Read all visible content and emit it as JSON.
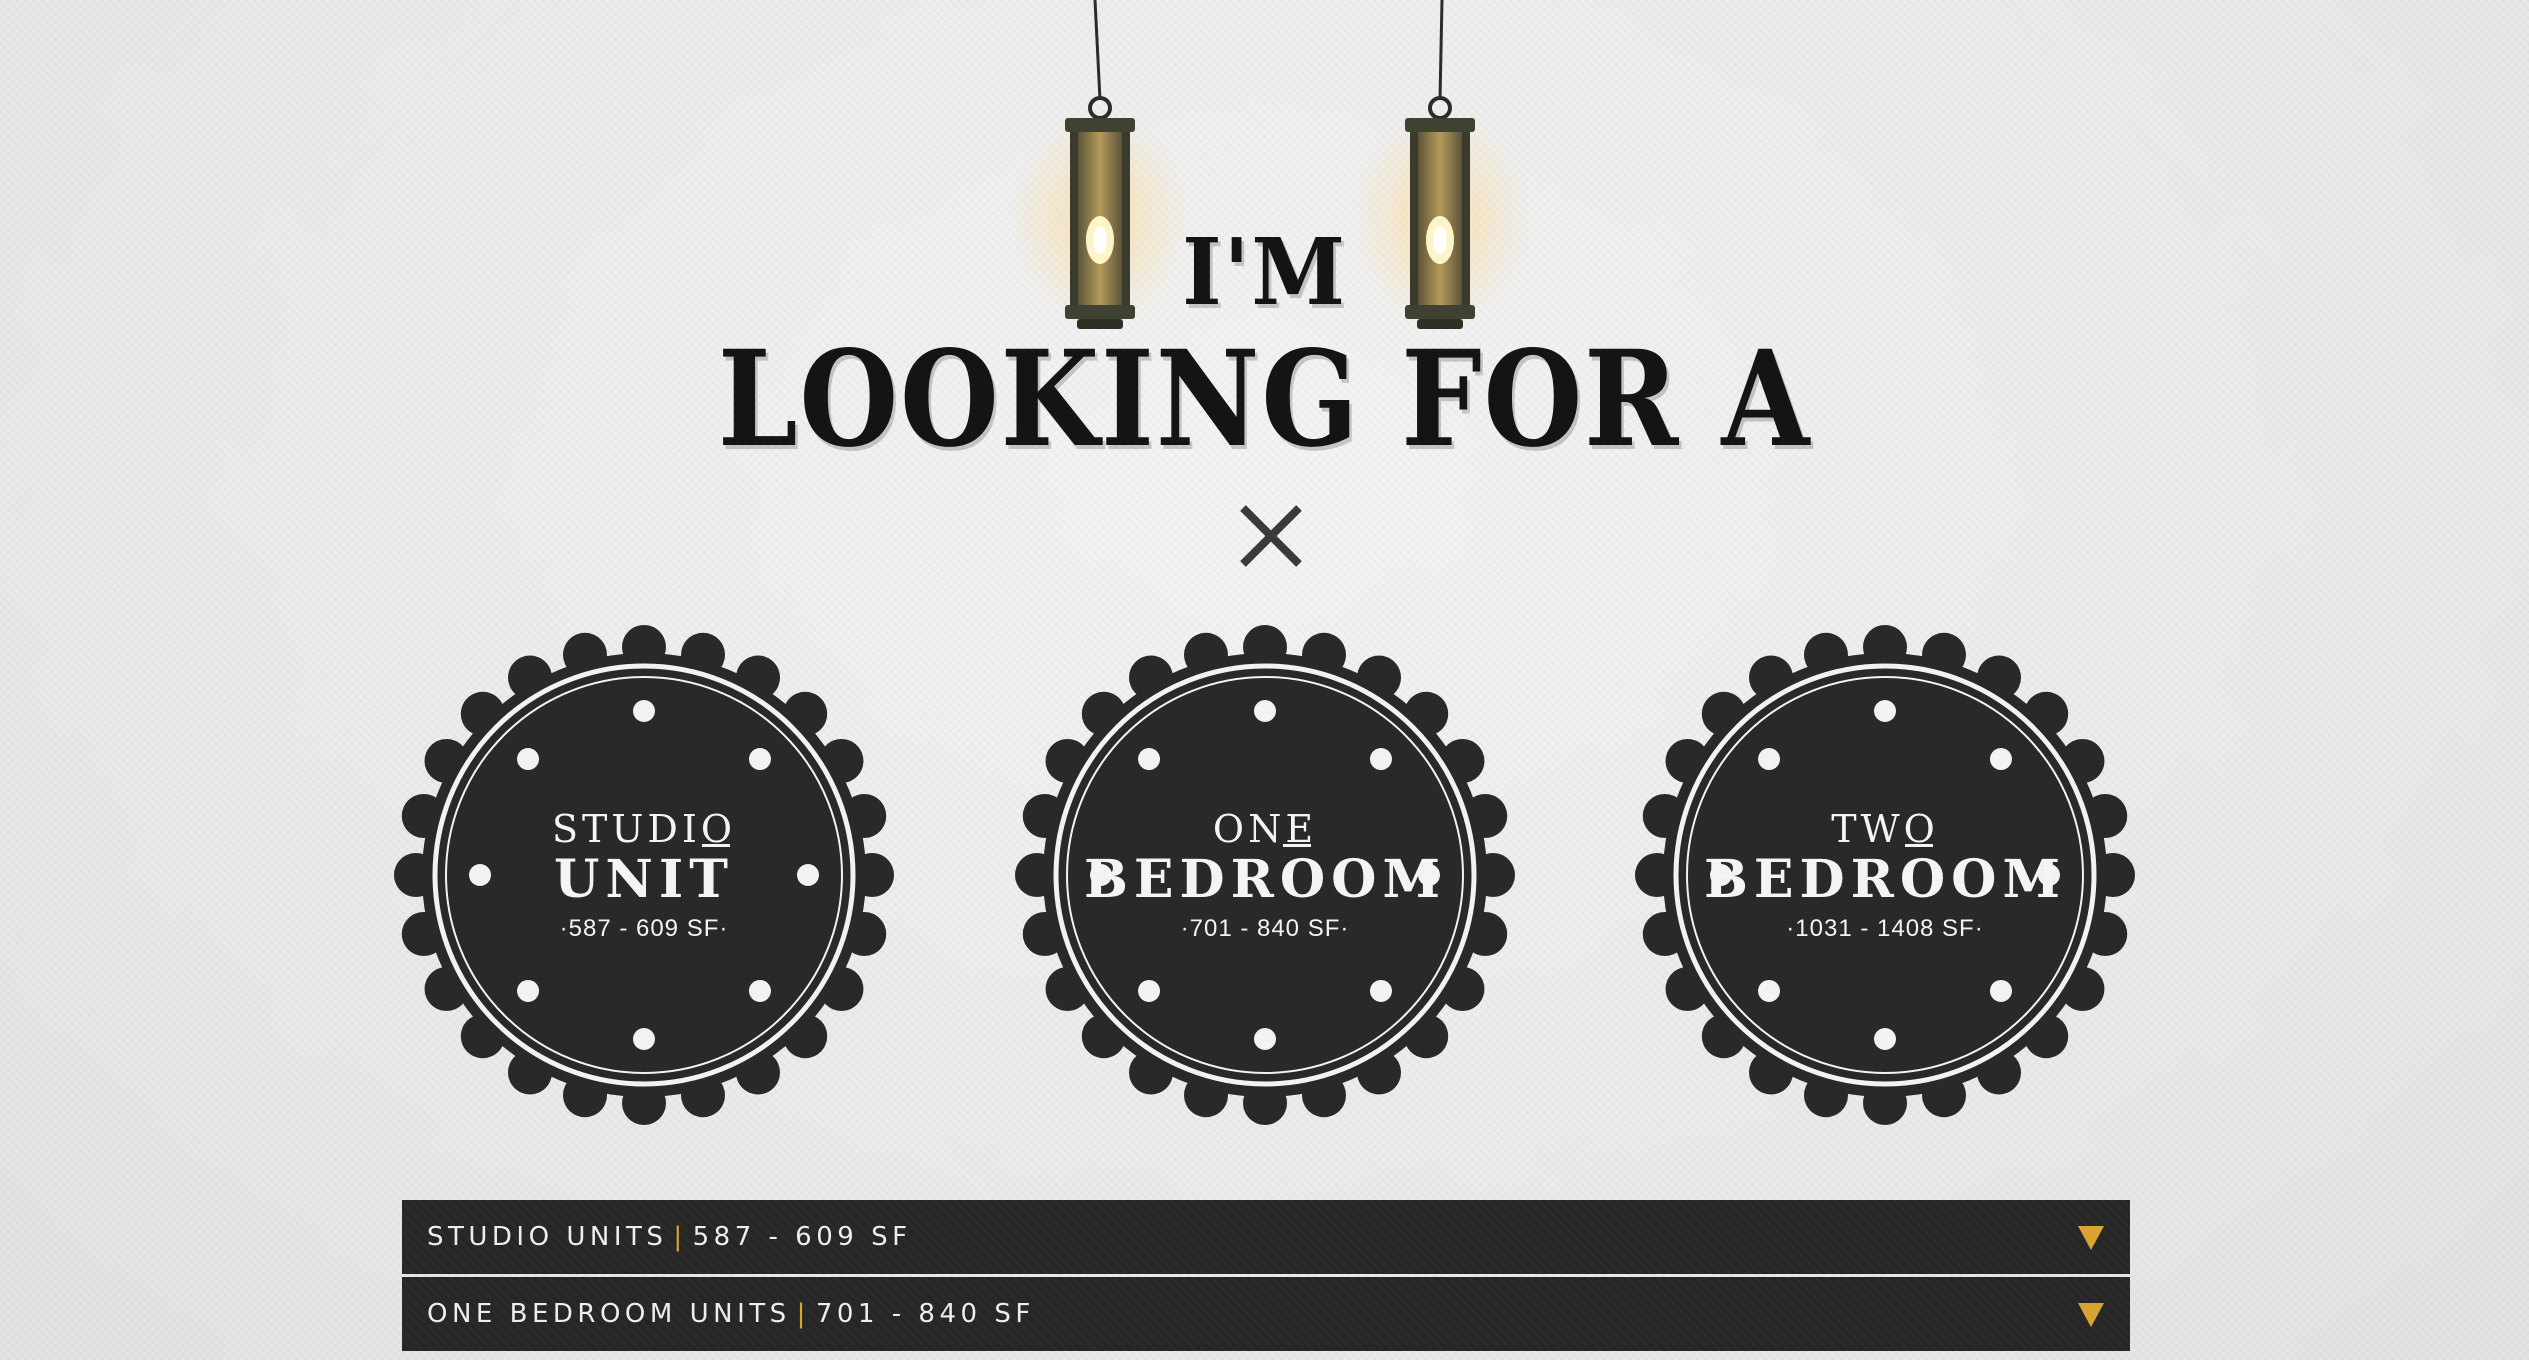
{
  "hero": {
    "line1": "I'M",
    "line2": "LOOKING FOR A"
  },
  "close": {
    "icon": "close-icon",
    "color": "#3a3a3a"
  },
  "units": [
    {
      "top": "STUDIO",
      "main": "UNIT",
      "range": "·587 - 609 SF·"
    },
    {
      "top": "ONE",
      "main": "BEDROOM",
      "range": "·701 - 840 SF·"
    },
    {
      "top": "TWO",
      "main": "BEDROOM",
      "range": "·1031 - 1408 SF·"
    }
  ],
  "accordion": [
    {
      "title": "STUDIO UNITS",
      "separator": "|",
      "range": "587 - 609 SF",
      "icon": "triangle-down-icon"
    },
    {
      "title": "ONE BEDROOM UNITS",
      "separator": "|",
      "range": "701 - 840 SF",
      "icon": "triangle-down-icon"
    }
  ],
  "colors": {
    "badge": "#2a2828",
    "accent": "#d9a531",
    "bar": "#262626",
    "text_dark": "#141414"
  }
}
